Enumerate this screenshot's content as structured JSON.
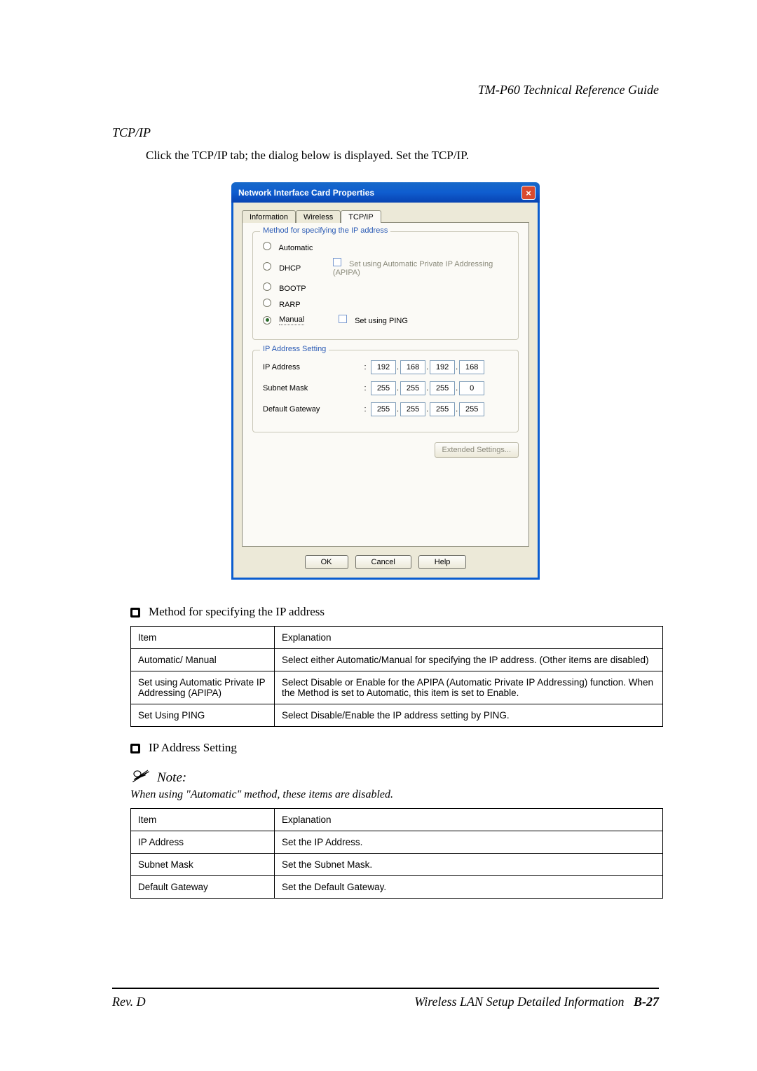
{
  "header": {
    "doc_title": "TM-P60 Technical Reference Guide"
  },
  "section": {
    "heading": "TCP/IP",
    "intro": "Click the TCP/IP tab; the dialog below is displayed. Set the TCP/IP."
  },
  "dialog": {
    "title": "Network Interface Card Properties",
    "close_glyph": "×",
    "tabs": {
      "info": "Information",
      "wireless": "Wireless",
      "tcpip": "TCP/IP"
    },
    "group_method": {
      "legend": "Method for specifying the IP address",
      "opts": {
        "automatic": "Automatic",
        "dhcp": "DHCP",
        "bootp": "BOOTP",
        "rarp": "RARP",
        "manual": "Manual"
      },
      "apipa_chk": "Set using Automatic Private IP Addressing (APIPA)",
      "ping_chk": "Set using PING"
    },
    "group_ip": {
      "legend": "IP Address Setting",
      "rows": {
        "ipaddr": {
          "label": "IP Address",
          "o1": "192",
          "o2": "168",
          "o3": "192",
          "o4": "168"
        },
        "mask": {
          "label": "Subnet Mask",
          "o1": "255",
          "o2": "255",
          "o3": "255",
          "o4": "0"
        },
        "gw": {
          "label": "Default Gateway",
          "o1": "255",
          "o2": "255",
          "o3": "255",
          "o4": "255"
        }
      },
      "ext_btn": "Extended Settings..."
    },
    "buttons": {
      "ok": "OK",
      "cancel": "Cancel",
      "help": "Help"
    }
  },
  "list1_title": "Method for specifying the IP address",
  "table1": {
    "head_item": "Item",
    "head_exp": "Explanation",
    "rows": [
      {
        "item": "Automatic/ Manual",
        "exp": "Select either Automatic/Manual for specifying the IP address. (Other items are disabled)"
      },
      {
        "item": "Set using Automatic Private IP Addressing (APIPA)",
        "exp": "Select Disable or Enable for the APIPA (Automatic Private IP Addressing) function. When the Method is set to Automatic, this item is set to Enable."
      },
      {
        "item": "Set Using PING",
        "exp": "Select Disable/Enable the IP address setting by PING."
      }
    ]
  },
  "list2_title": "IP Address Setting",
  "note": {
    "label": "Note:",
    "text": "When using \"Automatic\" method, these items are disabled."
  },
  "table2": {
    "head_item": "Item",
    "head_exp": "Explanation",
    "rows": [
      {
        "item": "IP Address",
        "exp": "Set the IP Address."
      },
      {
        "item": "Subnet Mask",
        "exp": "Set the Subnet Mask."
      },
      {
        "item": "Default Gateway",
        "exp": "Set the Default Gateway."
      }
    ]
  },
  "footer": {
    "rev": "Rev. D",
    "right_text": "Wireless LAN Setup Detailed Information",
    "page": "B-27"
  }
}
